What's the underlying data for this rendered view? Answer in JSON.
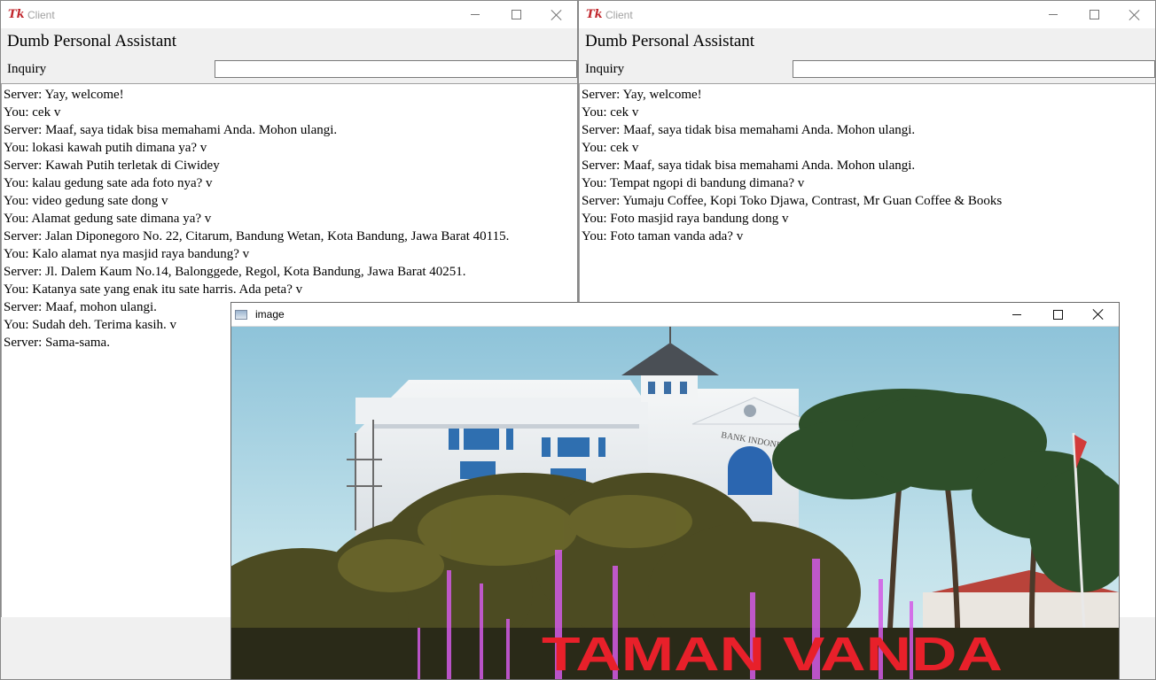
{
  "windows": [
    {
      "title": "Client",
      "icon": "tk-feather-icon",
      "heading": "Dumb Personal Assistant",
      "inquiry_label": "Inquiry",
      "inquiry_value": "",
      "messages": [
        "Server: Yay, welcome!",
        "You: cek v",
        "Server: Maaf, saya tidak bisa memahami Anda. Mohon ulangi.",
        "You: lokasi kawah putih dimana ya? v",
        "Server: Kawah Putih terletak di Ciwidey",
        "You: kalau gedung sate ada foto nya? v",
        "You: video gedung sate dong v",
        "You: Alamat gedung sate dimana ya? v",
        "Server: Jalan Diponegoro No. 22, Citarum, Bandung Wetan, Kota Bandung, Jawa Barat 40115.",
        "You: Kalo alamat nya masjid raya bandung? v",
        "Server: Jl. Dalem Kaum No.14, Balonggede, Regol, Kota Bandung, Jawa Barat 40251.",
        "You: Katanya sate yang enak itu sate harris. Ada peta? v",
        "Server: Maaf, mohon ulangi.",
        "You: Sudah deh. Terima kasih. v",
        "Server: Sama-sama."
      ]
    },
    {
      "title": "Client",
      "icon": "tk-feather-icon",
      "heading": "Dumb Personal Assistant",
      "inquiry_label": "Inquiry",
      "inquiry_value": "",
      "messages": [
        "Server: Yay, welcome!",
        "You: cek v",
        "Server: Maaf, saya tidak bisa memahami Anda. Mohon ulangi.",
        "You: cek v",
        "Server: Maaf, saya tidak bisa memahami Anda. Mohon ulangi.",
        "You: Tempat ngopi di bandung dimana? v",
        "Server: Yumaju Coffee, Kopi Toko Djawa, Contrast, Mr Guan Coffee & Books",
        "You: Foto masjid raya bandung dong v",
        "You: Foto taman vanda ada? v"
      ]
    }
  ],
  "image_window": {
    "title": "image",
    "photo": {
      "building_sign": "BANK INDONESIA",
      "sign_text": "TAMAN VANDA"
    }
  },
  "colors": {
    "tk_icon": "#c1272d",
    "sign_red": "#e8202a",
    "fountain": "#d35be6"
  }
}
